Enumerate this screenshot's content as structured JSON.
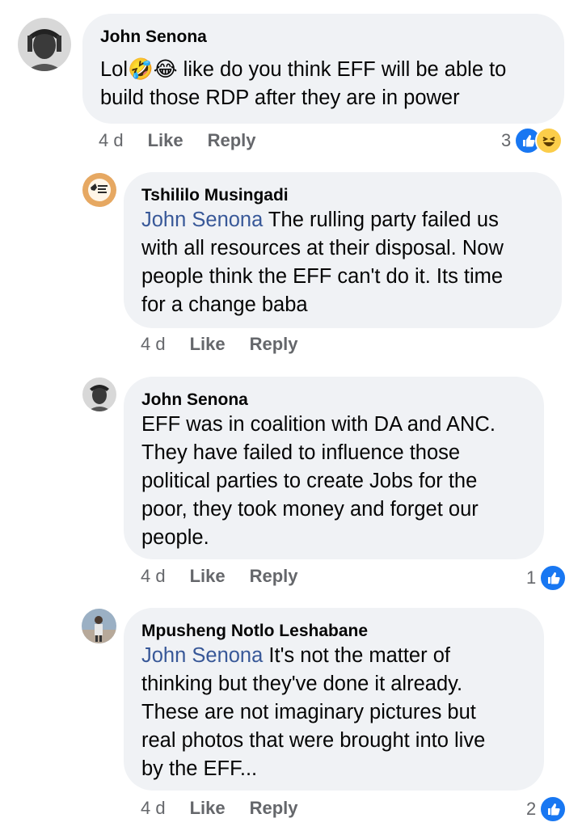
{
  "comments": [
    {
      "author": "John Senona",
      "mention": "",
      "text": "Lol🤣😂 like do you think EFF will be able to\nbuild those RDP after they are in power",
      "time": "4 d",
      "like_label": "Like",
      "reply_label": "Reply",
      "reaction_count": "3",
      "reactions": [
        "like-icon",
        "haha-icon"
      ]
    },
    {
      "author": "Tshililo Musingadi",
      "mention": "John Senona",
      "text": " The rulling party failed us\nwith all resources at their disposal. Now\npeople think the EFF can't do it. Its time\nfor a change baba",
      "time": "4 d",
      "like_label": "Like",
      "reply_label": "Reply"
    },
    {
      "author": "John Senona",
      "mention": "",
      "text": "EFF was in coalition with DA and ANC.\nThey have failed to influence those\npolitical parties to create Jobs for the\npoor, they took money and forget our\npeople.",
      "time": "4 d",
      "like_label": "Like",
      "reply_label": "Reply",
      "reaction_count": "1",
      "reactions": [
        "like-icon"
      ]
    },
    {
      "author": "Mpusheng Notlo Leshabane",
      "mention": "John Senona",
      "text": " It's not the matter of\nthinking but they've done it already.\nThese are not imaginary pictures but\nreal photos that were brought into live\nby the EFF...",
      "time": "4 d",
      "like_label": "Like",
      "reply_label": "Reply",
      "reaction_count": "2",
      "reactions": [
        "like-icon"
      ]
    }
  ],
  "colors": {
    "bubble": "#f0f2f5",
    "mention": "#385898",
    "meta": "#65676b",
    "like": "#1877f2",
    "haha": "#fbcd4a"
  }
}
